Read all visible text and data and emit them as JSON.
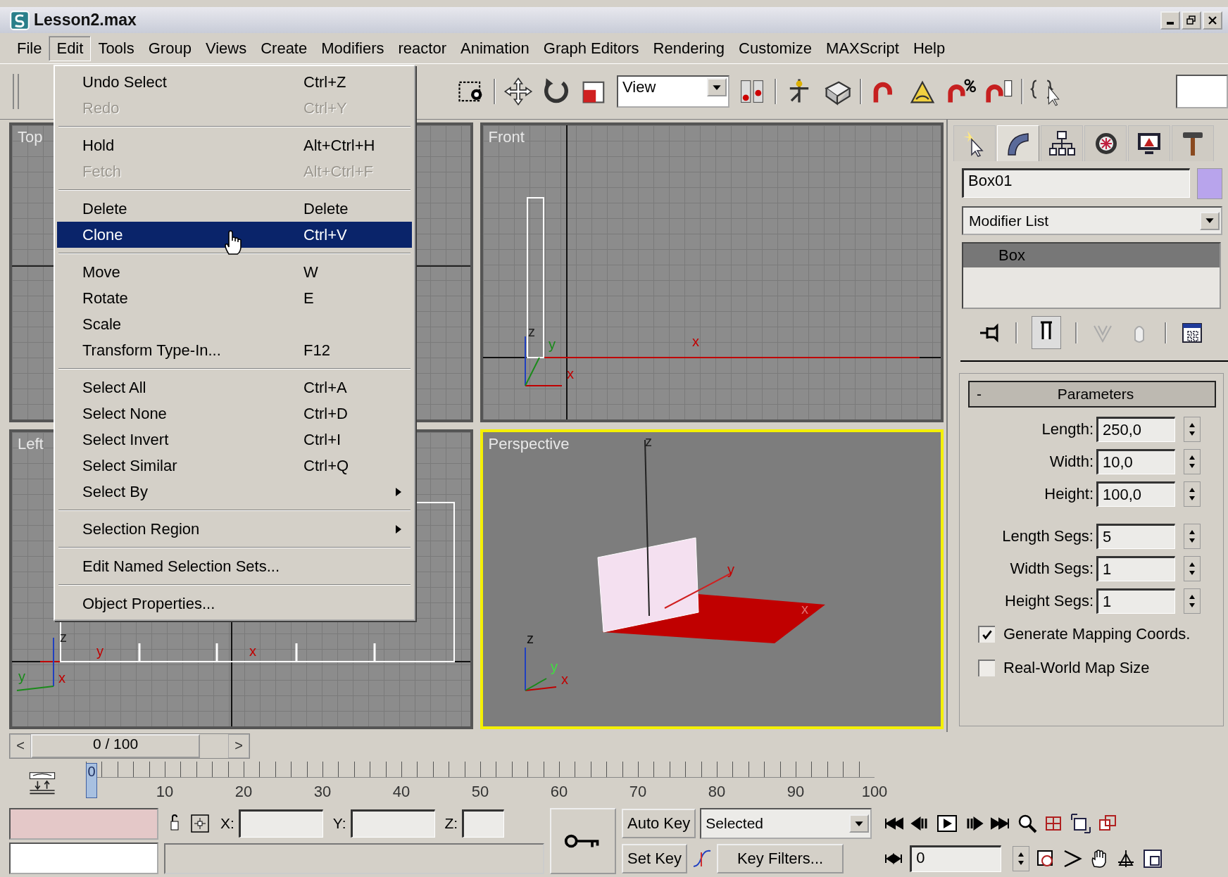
{
  "window": {
    "title": "Lesson2.max"
  },
  "menu_bar": [
    {
      "label": "File",
      "selected": false
    },
    {
      "label": "Edit",
      "selected": true
    },
    {
      "label": "Tools",
      "selected": false
    },
    {
      "label": "Group",
      "selected": false
    },
    {
      "label": "Views",
      "selected": false
    },
    {
      "label": "Create",
      "selected": false
    },
    {
      "label": "Modifiers",
      "selected": false
    },
    {
      "label": "reactor",
      "selected": false
    },
    {
      "label": "Animation",
      "selected": false
    },
    {
      "label": "Graph Editors",
      "selected": false
    },
    {
      "label": "Rendering",
      "selected": false
    },
    {
      "label": "Customize",
      "selected": false
    },
    {
      "label": "MAXScript",
      "selected": false
    },
    {
      "label": "Help",
      "selected": false
    }
  ],
  "edit_menu": [
    [
      {
        "label": "Undo Select",
        "shortcut": "Ctrl+Z",
        "disabled": false,
        "selected": false,
        "submenu": false
      },
      {
        "label": "Redo",
        "shortcut": "Ctrl+Y",
        "disabled": true,
        "selected": false,
        "submenu": false
      }
    ],
    [
      {
        "label": "Hold",
        "shortcut": "Alt+Ctrl+H",
        "disabled": false,
        "selected": false,
        "submenu": false
      },
      {
        "label": "Fetch",
        "shortcut": "Alt+Ctrl+F",
        "disabled": true,
        "selected": false,
        "submenu": false
      }
    ],
    [
      {
        "label": "Delete",
        "shortcut": "Delete",
        "disabled": false,
        "selected": false,
        "submenu": false
      },
      {
        "label": "Clone",
        "shortcut": "Ctrl+V",
        "disabled": false,
        "selected": true,
        "submenu": false
      }
    ],
    [
      {
        "label": "Move",
        "shortcut": "W",
        "disabled": false,
        "selected": false,
        "submenu": false
      },
      {
        "label": "Rotate",
        "shortcut": "E",
        "disabled": false,
        "selected": false,
        "submenu": false
      },
      {
        "label": "Scale",
        "disabled": false,
        "selected": false,
        "submenu": false
      },
      {
        "label": "Transform Type-In...",
        "shortcut": "F12",
        "disabled": false,
        "selected": false,
        "submenu": false
      }
    ],
    [
      {
        "label": "Select All",
        "shortcut": "Ctrl+A",
        "disabled": false,
        "selected": false,
        "submenu": false
      },
      {
        "label": "Select None",
        "shortcut": "Ctrl+D",
        "disabled": false,
        "selected": false,
        "submenu": false
      },
      {
        "label": "Select Invert",
        "shortcut": "Ctrl+I",
        "disabled": false,
        "selected": false,
        "submenu": false
      },
      {
        "label": "Select Similar",
        "shortcut": "Ctrl+Q",
        "disabled": false,
        "selected": false,
        "submenu": false
      },
      {
        "label": "Select By",
        "disabled": false,
        "selected": false,
        "submenu": true
      }
    ],
    [
      {
        "label": "Selection Region",
        "disabled": false,
        "selected": false,
        "submenu": true
      }
    ],
    [
      {
        "label": "Edit Named Selection Sets...",
        "disabled": false,
        "selected": false,
        "submenu": false
      }
    ],
    [
      {
        "label": "Object Properties...",
        "disabled": false,
        "selected": false,
        "submenu": false
      }
    ]
  ],
  "toolbar": {
    "view_dropdown": "View"
  },
  "viewports": [
    {
      "kind": "top",
      "label": "Top",
      "selected": false
    },
    {
      "kind": "front",
      "label": "Front",
      "selected": false,
      "labels": [
        "x",
        "z",
        "y",
        "x"
      ]
    },
    {
      "kind": "left",
      "label": "Left",
      "selected": false,
      "labels": [
        "y",
        "x",
        "z",
        "y",
        "x"
      ]
    },
    {
      "kind": "perspective",
      "label": "Perspective",
      "selected": true,
      "labels": [
        "z",
        "y",
        "x",
        "z",
        "y",
        "x"
      ]
    }
  ],
  "command_panel": {
    "tabs": [
      {
        "selected": false
      },
      {
        "selected": true
      },
      {
        "selected": false
      },
      {
        "selected": false
      },
      {
        "selected": false
      },
      {
        "selected": false
      }
    ],
    "object_name": "Box01",
    "modifier_list": "Modifier List",
    "stack": [
      {
        "label": "Box",
        "selected": true
      }
    ],
    "rollout": {
      "toggle": "-",
      "title": "Parameters",
      "fields": [
        {
          "label": "Length:",
          "value": "250,0"
        },
        {
          "label": "Width:",
          "value": "10,0"
        },
        {
          "label": "Height:",
          "value": "100,0"
        },
        {
          "label": "Length Segs:",
          "value": "5"
        },
        {
          "label": "Width Segs:",
          "value": "1"
        },
        {
          "label": "Height Segs:",
          "value": "1"
        }
      ],
      "checkboxes": [
        {
          "label": "Generate Mapping Coords.",
          "checked": true
        },
        {
          "label": "Real-World Map Size",
          "checked": false
        }
      ]
    }
  },
  "time_slider": {
    "prev": "<",
    "frame": "0 / 100",
    "level": 0,
    "next": ">"
  },
  "track_bar": {
    "current": "0",
    "ticks": [
      "10",
      "20",
      "30",
      "40",
      "50",
      "60",
      "70",
      "80",
      "90",
      "100"
    ]
  },
  "status": {
    "x_label": "X:",
    "y_label": "Y:",
    "z_label": "Z:",
    "auto_key": "Auto Key",
    "key_mode": "Selected",
    "set_key": "Set Key",
    "key_filters": "Key Filters...",
    "frame": "0"
  }
}
